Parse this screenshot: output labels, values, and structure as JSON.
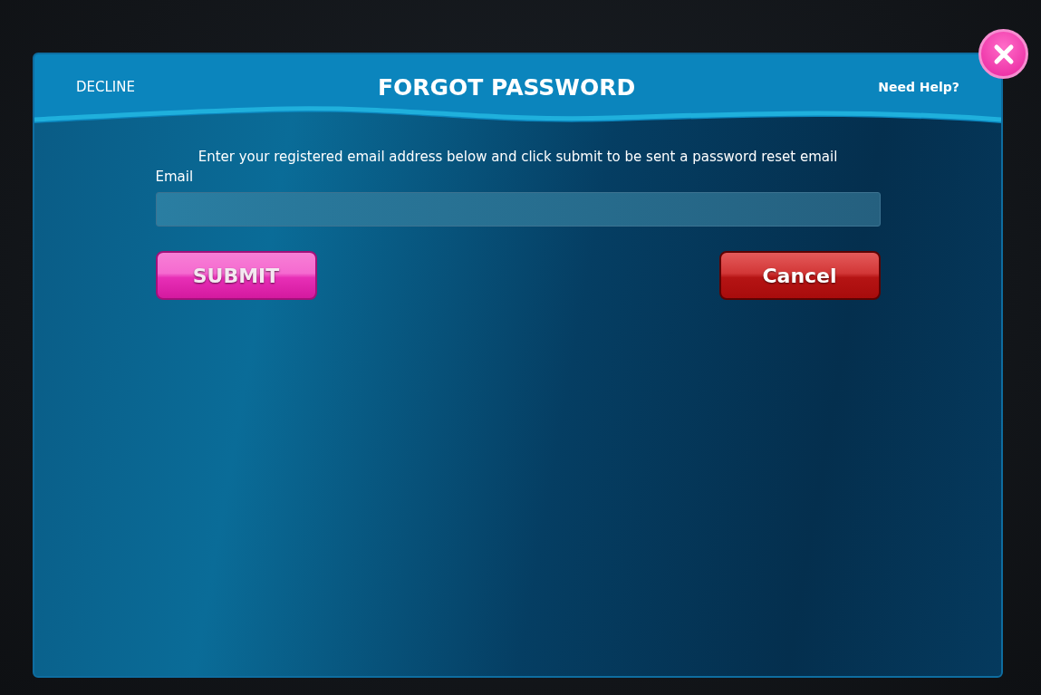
{
  "dialog": {
    "title": "FORGOT PASSWORD",
    "decline_link": "DECLINE",
    "help_link": "Need Help?",
    "instructions": "Enter your registered email address below and click submit to be sent a password reset email",
    "email_field": {
      "label": "Email"
    },
    "buttons": [
      {
        "label": "SUBMIT",
        "kind": "primary"
      },
      {
        "label": "Cancel",
        "kind": "cancel"
      }
    ]
  }
}
